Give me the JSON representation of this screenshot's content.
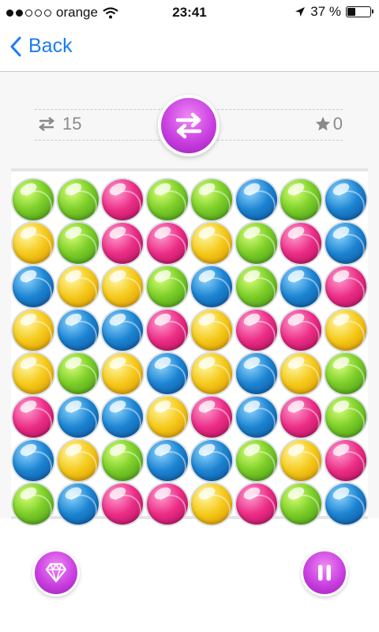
{
  "status_bar": {
    "signal_bars": 5,
    "signal_filled": 2,
    "carrier": "orange",
    "wifi_icon": "wifi-icon",
    "time": "23:41",
    "location_icon": "location-arrow-icon",
    "battery_percent": "37 %",
    "battery_level": 0.37,
    "battery_icon": "battery-icon"
  },
  "nav": {
    "back_label": "Back",
    "back_icon": "chevron-left-icon",
    "accent_color": "#1a7cf5"
  },
  "hud": {
    "moves_icon": "swap-arrows-icon",
    "moves_count": "15",
    "swap_button_icon": "swap-arrows-icon",
    "star_icon": "star-icon",
    "star_count": "0"
  },
  "board": {
    "colors": {
      "green": "#7fd02a",
      "pink": "#ec2d86",
      "blue": "#1c84d2",
      "yellow": "#f5c91a"
    },
    "rows": [
      [
        "green",
        "green",
        "pink",
        "green",
        "green",
        "blue",
        "green",
        "blue"
      ],
      [
        "yellow",
        "green",
        "pink",
        "pink",
        "yellow",
        "green",
        "pink",
        "blue"
      ],
      [
        "blue",
        "yellow",
        "yellow",
        "green",
        "blue",
        "green",
        "blue",
        "pink"
      ],
      [
        "yellow",
        "blue",
        "blue",
        "pink",
        "yellow",
        "pink",
        "pink",
        "yellow"
      ],
      [
        "yellow",
        "green",
        "yellow",
        "blue",
        "yellow",
        "blue",
        "yellow",
        "green"
      ],
      [
        "pink",
        "blue",
        "blue",
        "yellow",
        "pink",
        "blue",
        "pink",
        "green"
      ],
      [
        "blue",
        "yellow",
        "green",
        "blue",
        "blue",
        "green",
        "yellow",
        "pink"
      ],
      [
        "green",
        "blue",
        "pink",
        "pink",
        "yellow",
        "pink",
        "green",
        "blue"
      ]
    ]
  },
  "controls": {
    "gem_icon": "diamond-icon",
    "pause_icon": "pause-icon",
    "button_color": "#c93fe0"
  }
}
